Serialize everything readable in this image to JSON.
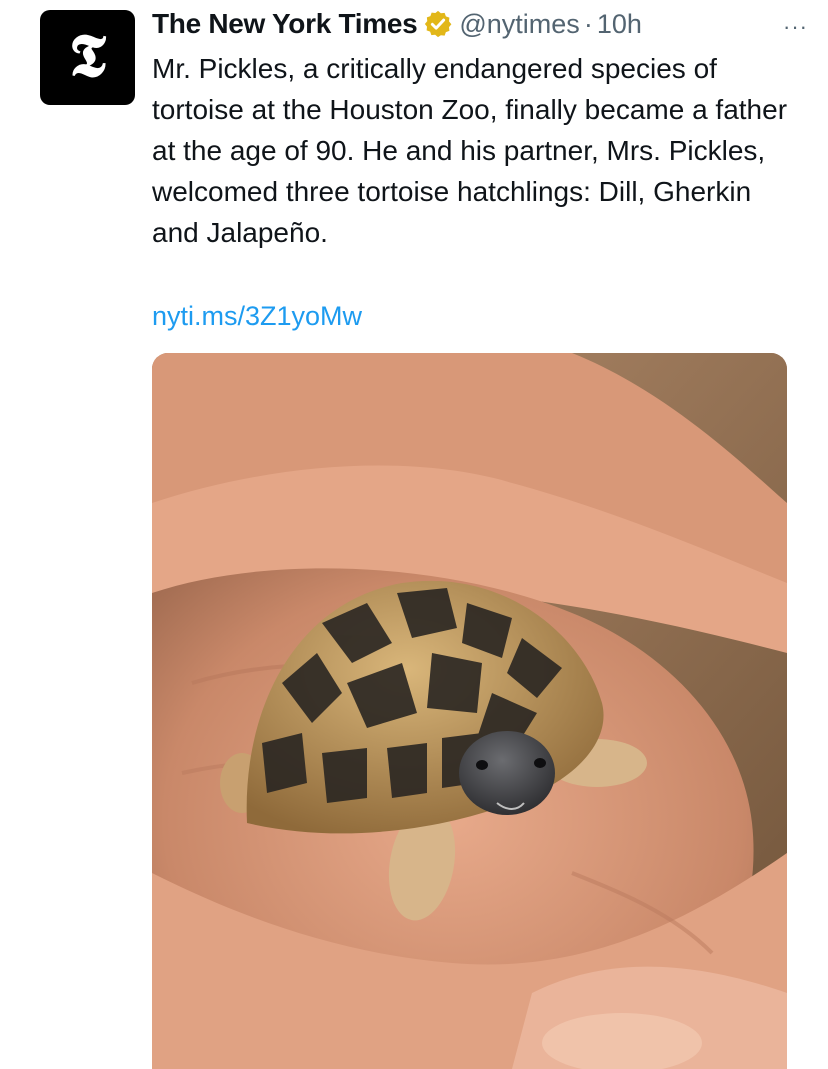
{
  "tweet": {
    "author_name": "The New York Times",
    "handle": "@nytimes",
    "separator": "·",
    "time": "10h",
    "more_label": "···",
    "avatar_glyph": "𝕿",
    "text": "Mr. Pickles, a critically endangered species of tortoise at the Houston Zoo, finally became a father at the age of 90. He and his partner, Mrs. Pickles, welcomed three tortoise hatchlings: Dill, Gherkin and Jalapeño.",
    "link": "nyti.ms/3Z1yoMw"
  },
  "icons": {
    "verified": "verified-badge-icon",
    "more": "more-options-icon",
    "avatar": "nyt-logo-icon"
  },
  "colors": {
    "link": "#1d9bf0",
    "verified_badge": "#e2b719",
    "secondary_text": "#536471",
    "avatar_bg": "#000000"
  }
}
